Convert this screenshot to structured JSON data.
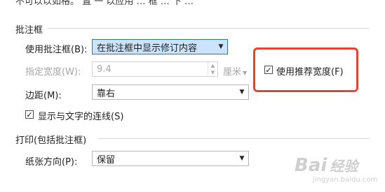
{
  "top_fragment": "不可以以如格。 置 一 以应用 … 框 … 下 …",
  "balloons_group": {
    "header": "批注框",
    "use_balloons": {
      "label": "使用批注框(B):",
      "value": "在批注框中显示修订内容"
    },
    "preferred_width": {
      "label": "指定宽度(W):",
      "value": "9.4",
      "unit": "厘米"
    },
    "use_recommended_width": {
      "label": "使用推荐宽度(F)",
      "checked": true
    },
    "margin": {
      "label": "边距(M):",
      "value": "靠右"
    },
    "show_lines": {
      "label": "显示与文字的连线(S)",
      "checked": true
    }
  },
  "print_group": {
    "header": "打印(包括批注框)",
    "orientation": {
      "label": "纸张方向(P):",
      "value": "保留"
    }
  },
  "watermark": {
    "brand": "Bai",
    "brand2": "经验",
    "url": "jingyan.baidu.com"
  },
  "colors": {
    "highlight": "#e8413a",
    "focus": "#2f6fd2",
    "focus_fill": "#cce4fb"
  },
  "icons": {
    "checkbox": "checkmark-icon",
    "dropdown": "chevron-down-icon",
    "spinner": "spin-updown-icon"
  }
}
